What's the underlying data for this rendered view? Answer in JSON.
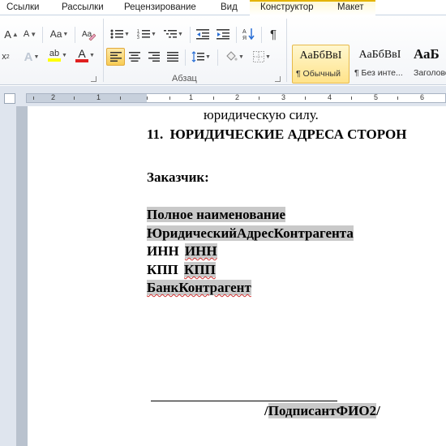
{
  "tabs": [
    "Ссылки",
    "Рассылки",
    "Рецензирование",
    "Вид",
    "Конструктор",
    "Макет"
  ],
  "ribbon": {
    "font": {
      "grow_label": "A",
      "shrink_label": "A",
      "case_label": "Aa",
      "superscript_label": "x",
      "effects_label": "A",
      "highlight_label": "ab",
      "font_color_label": "A"
    },
    "paragraph": {
      "group_label": "Абзац",
      "pilcrow": "¶"
    },
    "styles": [
      {
        "sample": "АаБбВвI",
        "name": "¶ Обычный"
      },
      {
        "sample": "АаБбВвI",
        "name": "¶ Без инте..."
      },
      {
        "sample": "АаБ",
        "name": "Заголово"
      }
    ]
  },
  "ruler": {
    "numbers": [
      "2",
      "1",
      "1",
      "2",
      "3",
      "4",
      "5",
      "6"
    ]
  },
  "document": {
    "line1": "юридическую силу.",
    "heading_num": "11.",
    "heading_text": "ЮРИДИЧЕСКИЕ АДРЕСА СТОРОН",
    "customer": "Заказчик:",
    "full_name": "Полное наименование",
    "legal_address": "ЮридическийАдресКонтрагента",
    "inn_label": "ИНН",
    "inn_value": "ИНН",
    "kpp_label": "КПП",
    "kpp_value": "КПП",
    "bank": "БанкКонтрагент",
    "signature_slash_open": "/",
    "signature_name": "ПодписантФИО2",
    "signature_slash_close": "/"
  },
  "colors": {
    "accent_underline": "#e3b300",
    "field_highlight": "#c9c9c9",
    "spelling_squiggle": "#d03030",
    "font_color_bar": "#e02020",
    "highlight_bar": "#ffff00"
  }
}
